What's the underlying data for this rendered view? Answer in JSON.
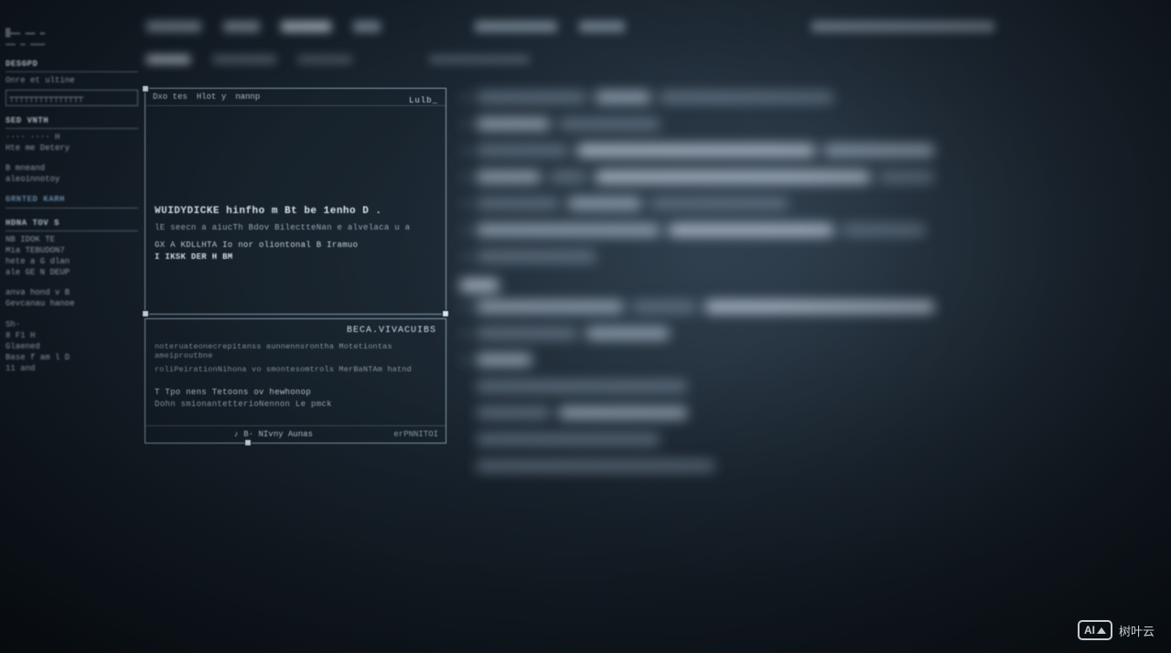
{
  "note": "This screenshot is an out-of-focus / stylised photograph of a computer monitor showing what appears to be a code editor or developer tool. Nearly all on-screen text is illegible due to motion blur, depth-of-field and synthetic rendering artefacts. Only fragmentary pseudo-words can be partially made out in the central panels.",
  "sidebar": {
    "section1_title": "DESGPD",
    "section1_line": "Onre et ultine",
    "section2_title": "SED VNTH",
    "section2_lines": [
      "···· ···· H",
      "Hte me Detery"
    ],
    "section3_lines": [
      "B mneand",
      "aleoinnotoy"
    ],
    "section4_title": "GRNTED KARH",
    "section5_title": "HDNA TOV S",
    "section5_lines": [
      "NB  IDOK TE",
      "Mia  TEBUDON7",
      "hete a G dlan",
      "ale  GE N DEUP"
    ],
    "section6_lines": [
      "anva hond v B",
      "Gevcanau hanoe"
    ],
    "section7_lines": [
      "Sh·",
      "8 F1 H",
      "Glaened",
      "Base f  am l D",
      "11 and"
    ]
  },
  "center_panel1": {
    "tabs": [
      "Dxo tes",
      "Hlot y",
      "nannp"
    ],
    "right_tag": "Lulb_",
    "title_line": "WUIDYDICKE hinfho m Bt be  1enho D .",
    "sub_line1": "lE seecn a aiucTh Bdov  BilectteNan e alvelaca u a",
    "sub_line2": "GX A KDLLHTA Io nor oliontonal B Iramuo",
    "sub_line3": "I IKSK DER H BM"
  },
  "center_panel2": {
    "heading": "BECA.VIVACUIBS",
    "dense1": "noteruateonecrepitanss aunnennsrontha Motetiontas ameiproutbne",
    "dense2": "roliPeirationNihona vo  smontesomtrols MerBaNTAm hatnd",
    "line1": "T Tpo nens Tetoons ov hewhonop",
    "line2": "Dohn smionantetterioNennon Le pmck",
    "foot_label": "♪ B·  NIvny Aunas",
    "foot_right": "erPNNITOI"
  },
  "watermark": {
    "badge_text": "AI",
    "label": "树叶云"
  }
}
